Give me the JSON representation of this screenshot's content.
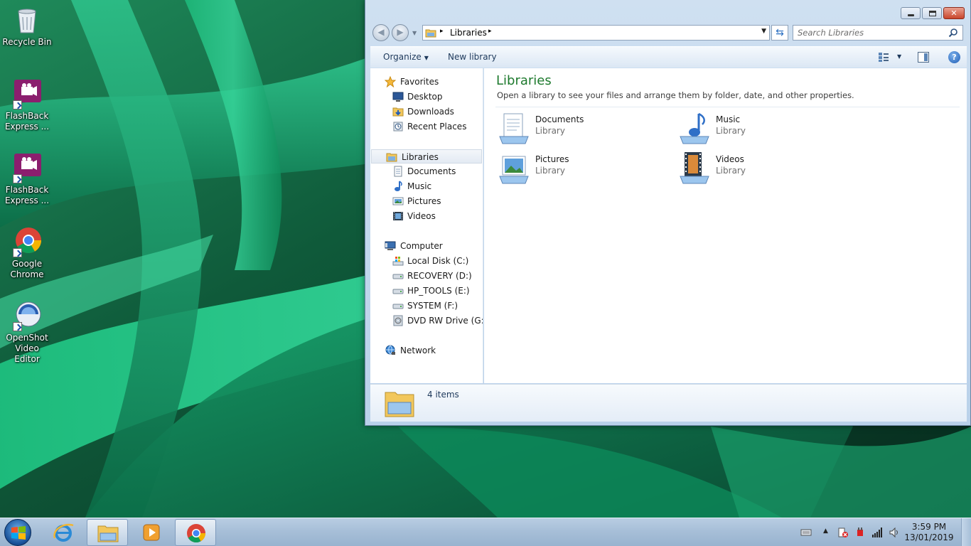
{
  "desktop": {
    "icons": [
      {
        "label": "Recycle Bin",
        "icon": "recycle-bin-icon"
      },
      {
        "label": "FlashBack Express ...",
        "icon": "flashback-icon"
      },
      {
        "label": "FlashBack Express ...",
        "icon": "flashback-icon"
      },
      {
        "label": "Google Chrome",
        "icon": "chrome-icon"
      },
      {
        "label": "OpenShot Video Editor",
        "icon": "openshot-icon"
      }
    ]
  },
  "explorer": {
    "address": {
      "crumb": "Libraries"
    },
    "search": {
      "placeholder": "Search Libraries"
    },
    "toolbar": {
      "organize": "Organize",
      "new_library": "New library"
    },
    "nav": {
      "favorites": {
        "label": "Favorites",
        "items": [
          "Desktop",
          "Downloads",
          "Recent Places"
        ]
      },
      "libraries": {
        "label": "Libraries",
        "items": [
          "Documents",
          "Music",
          "Pictures",
          "Videos"
        ]
      },
      "computer": {
        "label": "Computer",
        "items": [
          "Local Disk (C:)",
          "RECOVERY (D:)",
          "HP_TOOLS (E:)",
          "SYSTEM (F:)",
          "DVD RW Drive (G:) G"
        ]
      },
      "network": {
        "label": "Network"
      }
    },
    "content": {
      "title": "Libraries",
      "subtitle": "Open a library to see your files and arrange them by folder, date, and other properties.",
      "libraries": [
        {
          "name": "Documents",
          "type": "Library",
          "icon": "documents-library-icon"
        },
        {
          "name": "Music",
          "type": "Library",
          "icon": "music-library-icon"
        },
        {
          "name": "Pictures",
          "type": "Library",
          "icon": "pictures-library-icon"
        },
        {
          "name": "Videos",
          "type": "Library",
          "icon": "videos-library-icon"
        }
      ]
    },
    "details": {
      "count": "4 items"
    }
  },
  "taskbar": {
    "clock": {
      "time": "3:59 PM",
      "date": "13/01/2019"
    }
  },
  "colors": {
    "title_green": "#1e7a2e",
    "taskbar": "#a7bfd8"
  }
}
